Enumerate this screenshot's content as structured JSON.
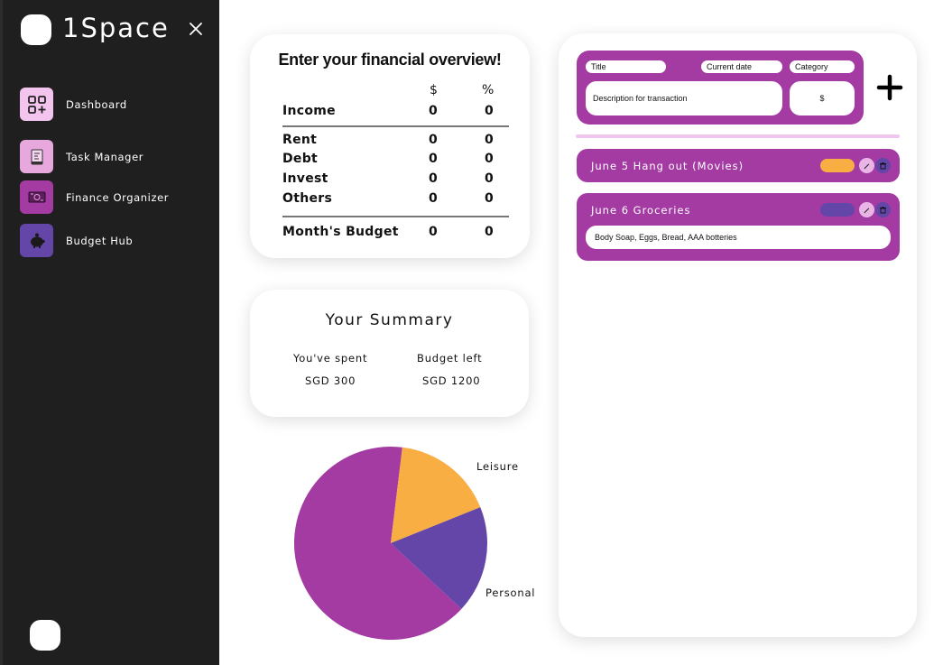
{
  "app": {
    "title": "1Space"
  },
  "colors": {
    "accent": "#a33ba3",
    "sidebar_bg": "#1f1f1f",
    "leisure": "#f8ae43",
    "personal": "#6446a9",
    "divider_pink": "#f0c6ef"
  },
  "sidebar": {
    "items": [
      {
        "label": "Dashboard",
        "icon": "grid-plus-icon"
      },
      {
        "label": "Task Manager",
        "icon": "notepad-icon"
      },
      {
        "label": "Finance Organizer",
        "icon": "money-icon"
      },
      {
        "label": "Budget Hub",
        "icon": "piggy-bank-icon"
      }
    ]
  },
  "overview": {
    "title": "Enter your financial overview!",
    "col_dollar": "$",
    "col_percent": "%",
    "income": {
      "label": "Income",
      "amount": "0",
      "percent": "0"
    },
    "expenses": [
      {
        "label": "Rent",
        "amount": "0",
        "percent": "0"
      },
      {
        "label": "Debt",
        "amount": "0",
        "percent": "0"
      },
      {
        "label": "Invest",
        "amount": "0",
        "percent": "0"
      },
      {
        "label": "Others",
        "amount": "0",
        "percent": "0"
      }
    ],
    "budget": {
      "label": "Month's Budget",
      "amount": "0",
      "percent": "0"
    }
  },
  "summary": {
    "title": "Your Summary",
    "spent_label": "You've spent",
    "spent_value": "SGD 300",
    "left_label": "Budget left",
    "left_value": "SGD 1200"
  },
  "chart_data": {
    "type": "pie",
    "slices": [
      {
        "label": "",
        "value": 65,
        "color": "#a33ba3"
      },
      {
        "label": "Leisure",
        "value": 17,
        "color": "#f8ae43"
      },
      {
        "label": "Personal",
        "value": 18,
        "color": "#6446a9"
      }
    ]
  },
  "transaction_form": {
    "title_placeholder": "Title",
    "date_placeholder": "Current date",
    "category_placeholder": "Category",
    "description_placeholder": "Description for transaction",
    "amount_placeholder": "$"
  },
  "transactions": [
    {
      "text": "June 5  Hang out (Movies)",
      "tag_color": "#f8ae43",
      "description": ""
    },
    {
      "text": "June 6  Groceries",
      "tag_color": "#6446a9",
      "description": "Body Soap, Eggs, Bread, AAA botteries"
    }
  ]
}
